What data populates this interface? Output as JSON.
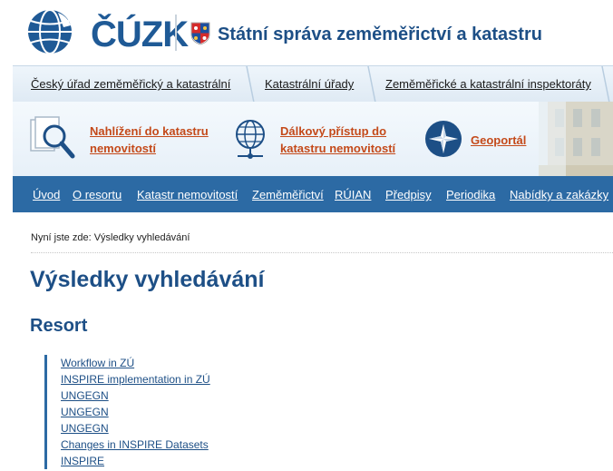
{
  "header": {
    "logo_text": "ČÚZK",
    "org_name": "Státní správa zeměměřictví a katastru"
  },
  "tabs": [
    {
      "label": "Český úřad zeměměřický a katastrální"
    },
    {
      "label": "Katastrální úřady"
    },
    {
      "label": "Zeměměřické a katastrální inspektoráty"
    }
  ],
  "features": {
    "nahlizeni": {
      "line1": "Nahlížení do katastru",
      "line2": "nemovitostí",
      "icon": "magnifier-document-icon"
    },
    "dalkovy": {
      "line1": "Dálkový přístup do",
      "line2": "katastru nemovitostí",
      "icon": "globe-network-icon"
    },
    "geoportal": {
      "label": "Geoportál",
      "icon": "compass-icon"
    }
  },
  "nav": [
    {
      "label": "Úvod"
    },
    {
      "label": "O resortu"
    },
    {
      "label": "Katastr nemovitostí"
    },
    {
      "label": "Zeměměřictví"
    },
    {
      "label": "RÚIAN"
    },
    {
      "label": "Předpisy"
    },
    {
      "label": "Periodika"
    },
    {
      "label": "Nabídky a zakázky"
    }
  ],
  "breadcrumb": "Nyní jste zde: Výsledky vyhledávání",
  "page_title": "Výsledky vyhledávání",
  "section_title": "Resort",
  "results": [
    "Workflow in ZÚ",
    "INSPIRE implementation in ZÚ",
    "UNGEGN",
    "UNGEGN",
    "UNGEGN",
    "Changes in INSPIRE Datasets",
    "INSPIRE"
  ],
  "colors": {
    "brand_blue": "#1d4f86",
    "nav_blue": "#2c6aa4",
    "feature_link": "#c44a1a"
  }
}
